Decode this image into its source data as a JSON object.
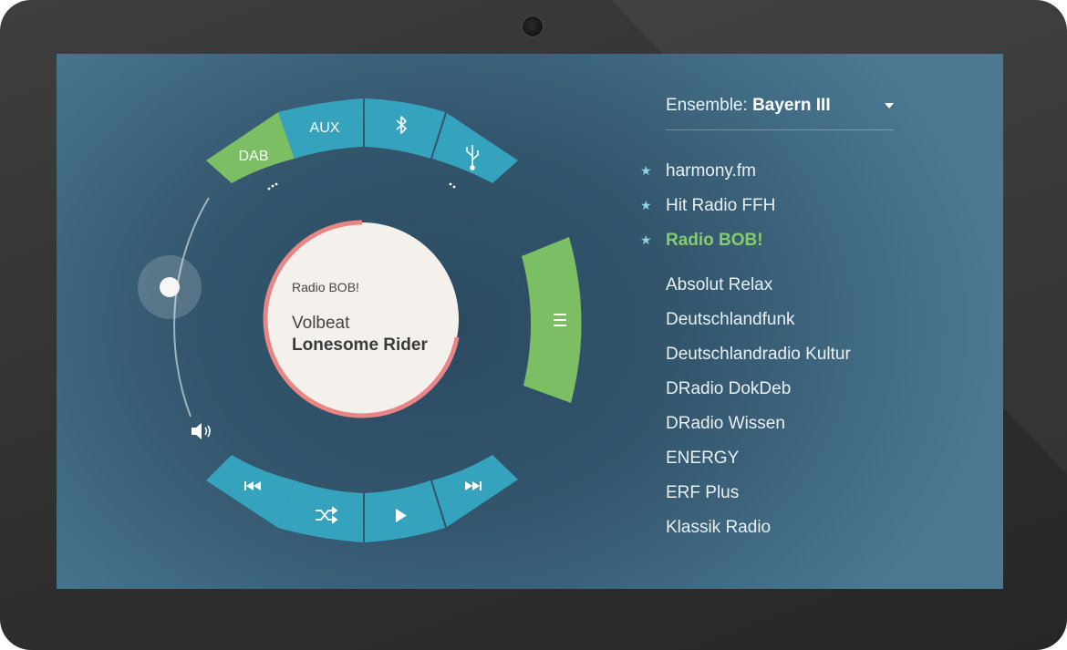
{
  "source_selector": {
    "items": [
      {
        "label": "DAB",
        "active": true
      },
      {
        "label": "AUX",
        "active": false
      },
      {
        "label": "",
        "icon": "bluetooth-icon",
        "active": false
      },
      {
        "label": "",
        "icon": "usb-icon",
        "active": false
      }
    ]
  },
  "now_playing": {
    "station": "Radio BOB!",
    "artist": "Volbeat",
    "title": "Lonesome Rider",
    "progress": 0.72
  },
  "volume": {
    "level": 0.6,
    "icon": "speaker-icon"
  },
  "menu_button": {
    "icon": "menu-icon"
  },
  "transport": {
    "buttons": [
      {
        "icon": "previous-icon"
      },
      {
        "icon": "shuffle-icon"
      },
      {
        "icon": "play-icon"
      },
      {
        "icon": "next-icon"
      }
    ]
  },
  "ensemble": {
    "label": "Ensemble:",
    "value": "Bayern III"
  },
  "stations": [
    {
      "name": "harmony.fm",
      "favorite": true,
      "active": false
    },
    {
      "name": "Hit Radio FFH",
      "favorite": true,
      "active": false
    },
    {
      "name": "Radio BOB!",
      "favorite": true,
      "active": true
    },
    {
      "name": "Absolut Relax",
      "favorite": false,
      "active": false
    },
    {
      "name": "Deutschlandfunk",
      "favorite": false,
      "active": false
    },
    {
      "name": "Deutschlandradio Kultur",
      "favorite": false,
      "active": false
    },
    {
      "name": "DRadio DokDeb",
      "favorite": false,
      "active": false
    },
    {
      "name": "DRadio Wissen",
      "favorite": false,
      "active": false
    },
    {
      "name": "ENERGY",
      "favorite": false,
      "active": false
    },
    {
      "name": "ERF Plus",
      "favorite": false,
      "active": false
    },
    {
      "name": "Klassik Radio",
      "favorite": false,
      "active": false
    }
  ],
  "colors": {
    "teal": "#35a3bd",
    "green": "#7cbe64",
    "accent_red": "#e98585",
    "disc": "#f4f1ec"
  }
}
